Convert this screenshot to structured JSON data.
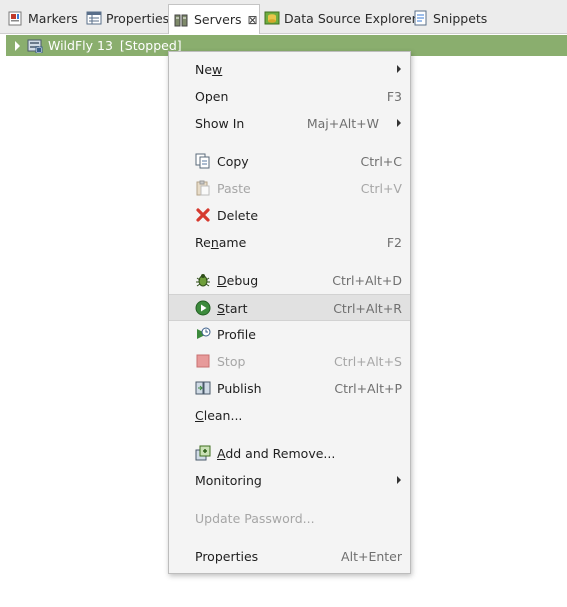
{
  "tabs": [
    {
      "label": "Markers",
      "icon": "markers-icon"
    },
    {
      "label": "Properties",
      "icon": "properties-icon"
    },
    {
      "label": "Servers",
      "icon": "servers-icon",
      "active": true,
      "close": "⊠"
    },
    {
      "label": "Data Source Explorer",
      "icon": "data-source-icon"
    },
    {
      "label": "Snippets",
      "icon": "snippets-icon"
    }
  ],
  "server": {
    "name": "WildFly 13",
    "status": "[Stopped]",
    "row_color": "#8aae6e"
  },
  "menu": {
    "new": {
      "pre": "Ne",
      "mn": "w",
      "post": ""
    },
    "open": {
      "label": "Open",
      "shortcut": "F3"
    },
    "show_in": {
      "label": "Show In",
      "shortcut": "Maj+Alt+W"
    },
    "copy": {
      "label": "Copy",
      "shortcut": "Ctrl+C"
    },
    "paste": {
      "label": "Paste",
      "shortcut": "Ctrl+V"
    },
    "delete": {
      "label": "Delete",
      "shortcut": ""
    },
    "rename": {
      "pre": "Re",
      "mn": "n",
      "post": "ame",
      "shortcut": "F2"
    },
    "debug": {
      "pre": "",
      "mn": "D",
      "post": "ebug",
      "shortcut": "Ctrl+Alt+D"
    },
    "start": {
      "pre": "",
      "mn": "S",
      "post": "tart",
      "shortcut": "Ctrl+Alt+R"
    },
    "profile": {
      "pre": "Prof",
      "mn": "i",
      "post": "le",
      "shortcut": ""
    },
    "stop": {
      "label": "Stop",
      "shortcut": "Ctrl+Alt+S"
    },
    "publish": {
      "label": "Publish",
      "shortcut": "Ctrl+Alt+P"
    },
    "clean": {
      "pre": "",
      "mn": "C",
      "post": "lean...",
      "shortcut": ""
    },
    "add_remove": {
      "pre": "",
      "mn": "A",
      "post": "dd and Remove...",
      "shortcut": ""
    },
    "monitoring": {
      "label": "Monitoring"
    },
    "update_password": {
      "label": "Update Password..."
    },
    "properties": {
      "label": "Properties",
      "shortcut": "Alt+Enter"
    }
  }
}
